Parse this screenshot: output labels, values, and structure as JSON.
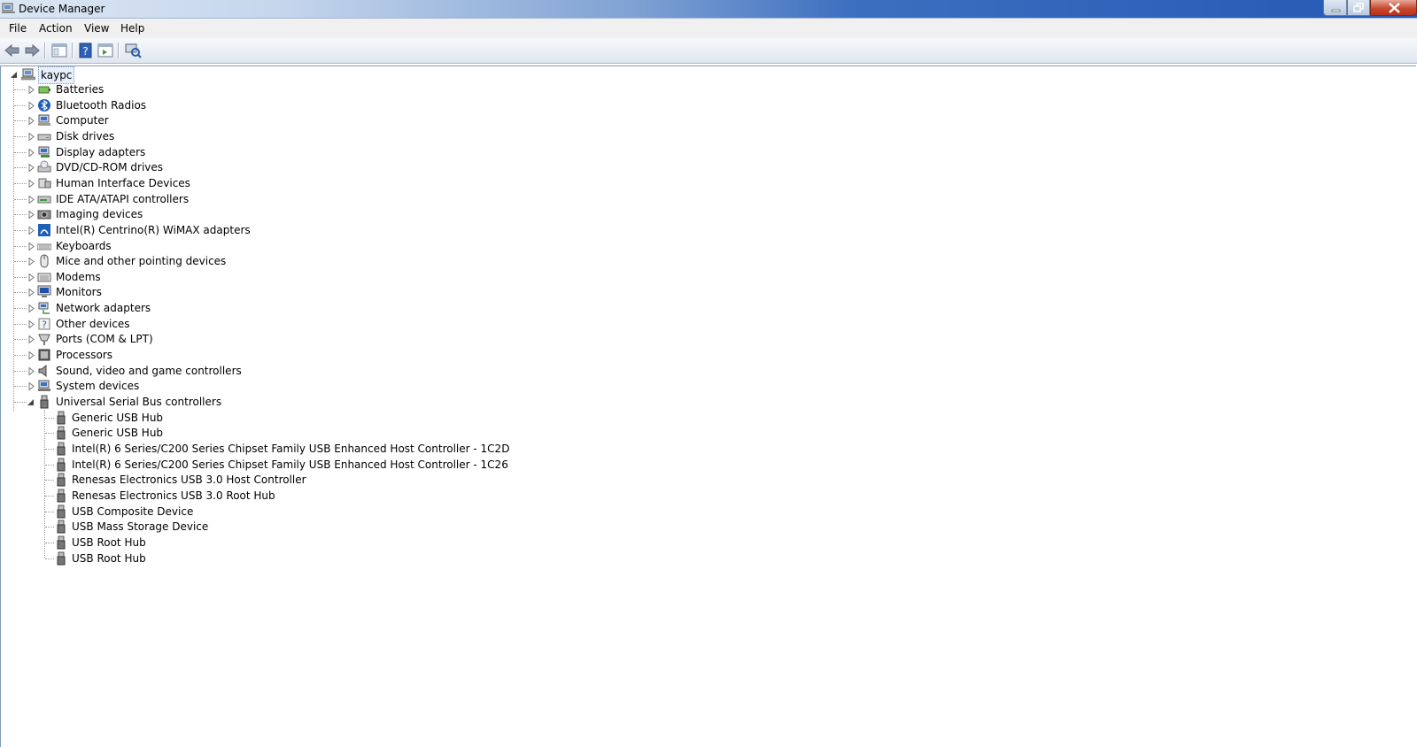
{
  "window": {
    "title": "Device Manager"
  },
  "menu": {
    "file": "File",
    "action": "Action",
    "view": "View",
    "help": "Help"
  },
  "tree": {
    "root": "kaypc",
    "categories": [
      {
        "label": "Batteries",
        "icon": "battery-icon"
      },
      {
        "label": "Bluetooth Radios",
        "icon": "bluetooth-icon"
      },
      {
        "label": "Computer",
        "icon": "computer-icon"
      },
      {
        "label": "Disk drives",
        "icon": "disk-drive-icon"
      },
      {
        "label": "Display adapters",
        "icon": "display-adapter-icon"
      },
      {
        "label": "DVD/CD-ROM drives",
        "icon": "dvd-drive-icon"
      },
      {
        "label": "Human Interface Devices",
        "icon": "hid-icon"
      },
      {
        "label": "IDE ATA/ATAPI controllers",
        "icon": "ide-controller-icon"
      },
      {
        "label": "Imaging devices",
        "icon": "imaging-icon"
      },
      {
        "label": "Intel(R) Centrino(R) WiMAX adapters",
        "icon": "wimax-icon"
      },
      {
        "label": "Keyboards",
        "icon": "keyboard-icon"
      },
      {
        "label": "Mice and other pointing devices",
        "icon": "mouse-icon"
      },
      {
        "label": "Modems",
        "icon": "modem-icon"
      },
      {
        "label": "Monitors",
        "icon": "monitor-icon"
      },
      {
        "label": "Network adapters",
        "icon": "network-icon"
      },
      {
        "label": "Other devices",
        "icon": "unknown-device-icon"
      },
      {
        "label": "Ports (COM & LPT)",
        "icon": "port-icon"
      },
      {
        "label": "Processors",
        "icon": "processor-icon"
      },
      {
        "label": "Sound, video and game controllers",
        "icon": "speaker-icon"
      },
      {
        "label": "System devices",
        "icon": "system-icon"
      },
      {
        "label": "Universal Serial Bus controllers",
        "icon": "usb-icon"
      }
    ],
    "usb_children": [
      "Generic USB Hub",
      "Generic USB Hub",
      "Intel(R) 6 Series/C200 Series Chipset Family USB Enhanced Host Controller - 1C2D",
      "Intel(R) 6 Series/C200 Series Chipset Family USB Enhanced Host Controller - 1C26",
      "Renesas Electronics USB 3.0 Host Controller",
      "Renesas Electronics USB 3.0 Root Hub",
      "USB Composite Device",
      "USB Mass Storage Device",
      "USB Root Hub",
      "USB Root Hub"
    ]
  }
}
